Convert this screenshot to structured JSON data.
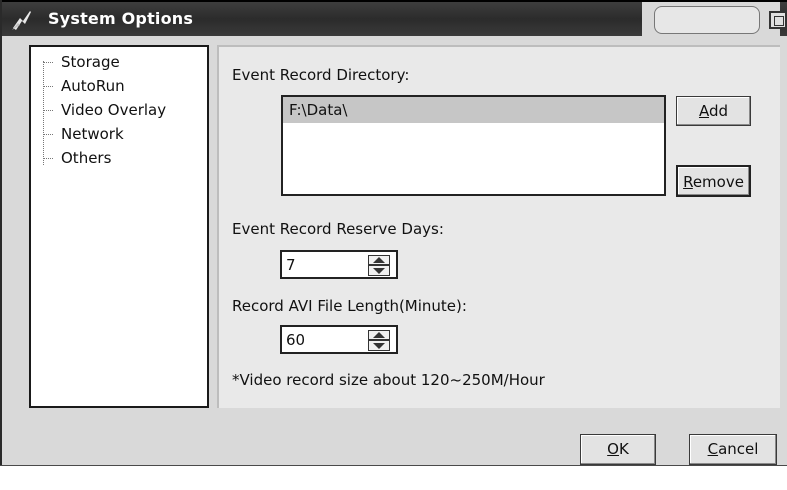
{
  "window": {
    "title": "System Options",
    "icon": "app-icon"
  },
  "tree": {
    "items": [
      {
        "label": "Storage"
      },
      {
        "label": "AutoRun"
      },
      {
        "label": "Video Overlay"
      },
      {
        "label": "Network"
      },
      {
        "label": "Others"
      }
    ]
  },
  "storage": {
    "directory_label": "Event Record Directory:",
    "directories": [
      "F:\\Data\\"
    ],
    "add_label": "dd",
    "add_mnemonic": "A",
    "remove_label": "emove",
    "remove_mnemonic": "R",
    "reserve_days_label": "Event Record Reserve Days:",
    "reserve_days_value": "7",
    "file_length_label": "Record AVI File Length(Minute):",
    "file_length_value": "60",
    "note": "*Video record size about 120~250M/Hour"
  },
  "footer": {
    "ok_mnemonic": "O",
    "ok_rest": "K",
    "cancel_mnemonic": "C",
    "cancel_rest": "ancel"
  }
}
